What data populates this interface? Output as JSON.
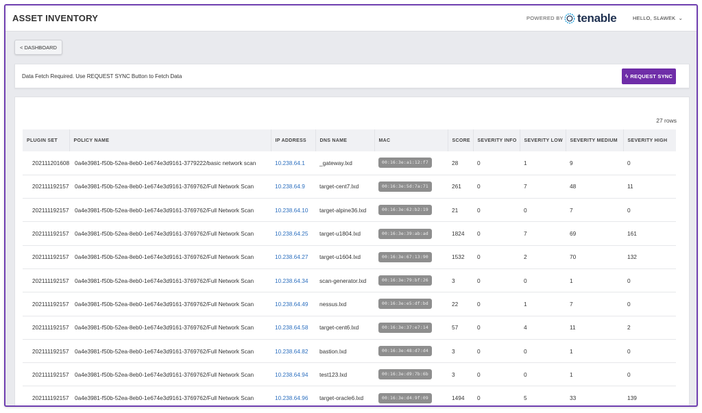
{
  "header": {
    "title": "ASSET INVENTORY",
    "powered_by": "POWERED BY",
    "brand": "tenable",
    "user_greeting": "HELLO, SLAWEK",
    "brand_color": "#1e3050"
  },
  "nav": {
    "dashboard_label": "< DASHBOARD"
  },
  "alert": {
    "message": "Data Fetch Required. Use REQUEST SYNC Button to Fetch Data",
    "sync_label": "REQUEST SYNC",
    "sync_color": "#6f2da8"
  },
  "table": {
    "row_count": "27 rows",
    "columns": [
      "PLUGIN SET",
      "POLICY NAME",
      "IP ADDRESS",
      "DNS NAME",
      "MAC",
      "SCORE",
      "SEVERITY INFO",
      "SEVERITY LOW",
      "SEVERITY MEDIUM",
      "SEVERITY HIGH"
    ],
    "rows": [
      {
        "plugin": "202111201608",
        "policy": "0a4e3981-f50b-52ea-8eb0-1e674e3d9161-3779222/basic network scan",
        "ip": "10.238.64.1",
        "dns": "_gateway.lxd",
        "mac": "00:16:3e:a1:12:f7",
        "score": "28",
        "info": "0",
        "low": "1",
        "medium": "9",
        "high": "0"
      },
      {
        "plugin": "202111192157",
        "policy": "0a4e3981-f50b-52ea-8eb0-1e674e3d9161-3769762/Full Network Scan",
        "ip": "10.238.64.9",
        "dns": "target-cent7.lxd",
        "mac": "00:16:3e:5d:7a:71",
        "score": "261",
        "info": "0",
        "low": "7",
        "medium": "48",
        "high": "11"
      },
      {
        "plugin": "202111192157",
        "policy": "0a4e3981-f50b-52ea-8eb0-1e674e3d9161-3769762/Full Network Scan",
        "ip": "10.238.64.10",
        "dns": "target-alpine36.lxd",
        "mac": "00:16:3e:62:b2:19",
        "score": "21",
        "info": "0",
        "low": "0",
        "medium": "7",
        "high": "0"
      },
      {
        "plugin": "202111192157",
        "policy": "0a4e3981-f50b-52ea-8eb0-1e674e3d9161-3769762/Full Network Scan",
        "ip": "10.238.64.25",
        "dns": "target-u1804.lxd",
        "mac": "00:16:3e:39:ab:ad",
        "score": "1824",
        "info": "0",
        "low": "7",
        "medium": "69",
        "high": "161"
      },
      {
        "plugin": "202111192157",
        "policy": "0a4e3981-f50b-52ea-8eb0-1e674e3d9161-3769762/Full Network Scan",
        "ip": "10.238.64.27",
        "dns": "target-u1604.lxd",
        "mac": "00:16:3e:67:13:90",
        "score": "1532",
        "info": "0",
        "low": "2",
        "medium": "70",
        "high": "132"
      },
      {
        "plugin": "202111192157",
        "policy": "0a4e3981-f50b-52ea-8eb0-1e674e3d9161-3769762/Full Network Scan",
        "ip": "10.238.64.34",
        "dns": "scan-generator.lxd",
        "mac": "00:16:3e:79:bf:26",
        "score": "3",
        "info": "0",
        "low": "0",
        "medium": "1",
        "high": "0"
      },
      {
        "plugin": "202111192157",
        "policy": "0a4e3981-f50b-52ea-8eb0-1e674e3d9161-3769762/Full Network Scan",
        "ip": "10.238.64.49",
        "dns": "nessus.lxd",
        "mac": "00:16:3e:e5:df:bd",
        "score": "22",
        "info": "0",
        "low": "1",
        "medium": "7",
        "high": "0"
      },
      {
        "plugin": "202111192157",
        "policy": "0a4e3981-f50b-52ea-8eb0-1e674e3d9161-3769762/Full Network Scan",
        "ip": "10.238.64.58",
        "dns": "target-cent6.lxd",
        "mac": "00:16:3e:37:e7:14",
        "score": "57",
        "info": "0",
        "low": "4",
        "medium": "11",
        "high": "2"
      },
      {
        "plugin": "202111192157",
        "policy": "0a4e3981-f50b-52ea-8eb0-1e674e3d9161-3769762/Full Network Scan",
        "ip": "10.238.64.82",
        "dns": "bastion.lxd",
        "mac": "00:16:3e:48:d7:d4",
        "score": "3",
        "info": "0",
        "low": "0",
        "medium": "1",
        "high": "0"
      },
      {
        "plugin": "202111192157",
        "policy": "0a4e3981-f50b-52ea-8eb0-1e674e3d9161-3769762/Full Network Scan",
        "ip": "10.238.64.94",
        "dns": "test123.lxd",
        "mac": "00:16:3e:d9:7b:6b",
        "score": "3",
        "info": "0",
        "low": "0",
        "medium": "1",
        "high": "0"
      },
      {
        "plugin": "202111192157",
        "policy": "0a4e3981-f50b-52ea-8eb0-1e674e3d9161-3769762/Full Network Scan",
        "ip": "10.238.64.96",
        "dns": "target-oracle6.lxd",
        "mac": "00:16:3e:d4:9f:09",
        "score": "1494",
        "info": "0",
        "low": "5",
        "medium": "33",
        "high": "139"
      }
    ]
  }
}
